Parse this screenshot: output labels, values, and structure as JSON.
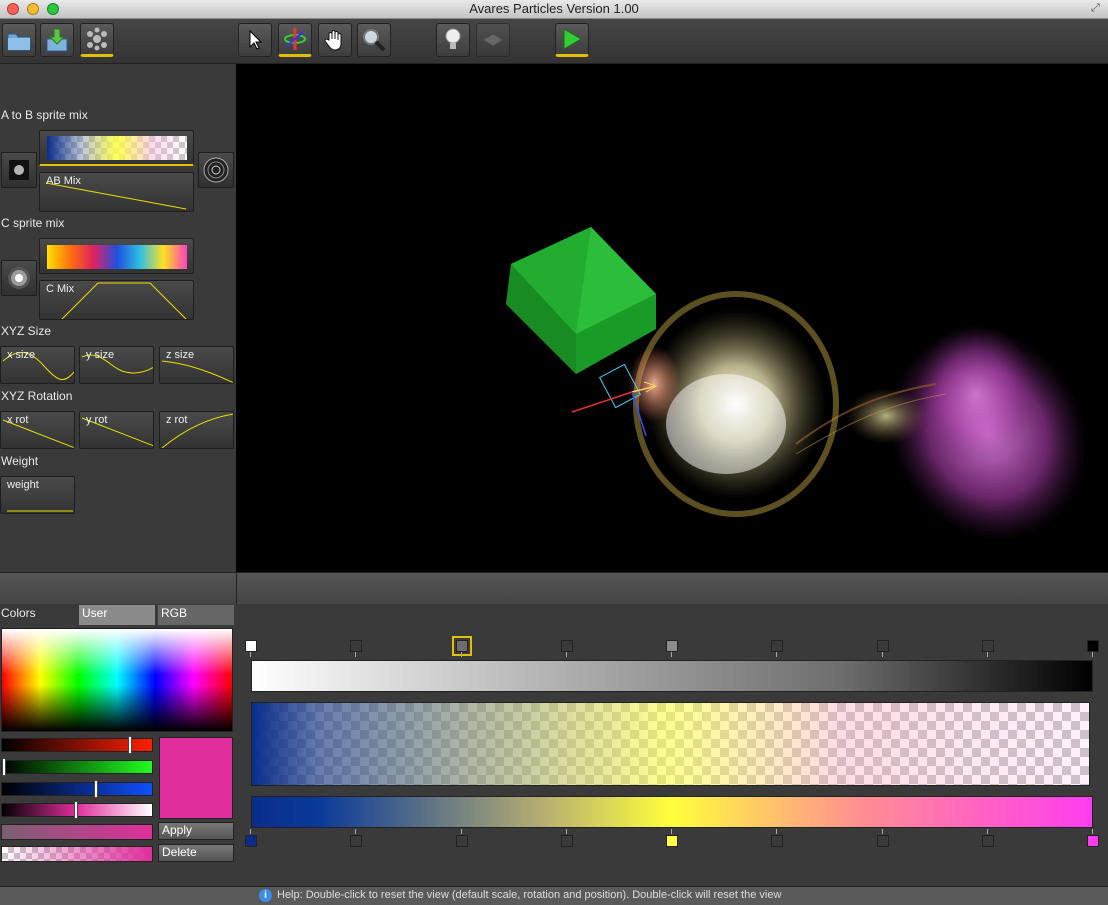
{
  "window": {
    "title": "Avares Particles Version 1.00",
    "colors": {
      "close": "#ff5f57",
      "minimize": "#ffbd2e",
      "zoom": "#28c940"
    }
  },
  "toolbar": {
    "buttons": [
      {
        "name": "open-folder-icon",
        "active": false
      },
      {
        "name": "import-download-icon",
        "active": false
      },
      {
        "name": "particles-icon",
        "active": true
      },
      {
        "name": "pointer-arrow-icon",
        "active": false
      },
      {
        "name": "rotate-gizmo-icon",
        "active": true
      },
      {
        "name": "hand-pan-icon",
        "active": false
      },
      {
        "name": "magnifier-zoom-icon",
        "active": false
      },
      {
        "name": "light-bulb-icon",
        "active": false
      },
      {
        "name": "render-grid-icon",
        "active": false
      },
      {
        "name": "play-icon",
        "active": true
      }
    ]
  },
  "left_panel": {
    "ab_section": {
      "label": "A to B sprite mix",
      "curve_label": "AB Mix"
    },
    "c_section": {
      "label": "C sprite mix",
      "curve_label": "C Mix"
    },
    "size_section": {
      "label": "XYZ Size",
      "x": "x size",
      "y": "y size",
      "z": "z size"
    },
    "rotation_section": {
      "label": "XYZ Rotation",
      "x": "x rot",
      "y": "y rot",
      "z": "z rot"
    },
    "weight_section": {
      "label": "Weight",
      "curve_label": "weight"
    }
  },
  "colors_panel": {
    "title": "Colors",
    "tabs": [
      "User",
      "RGB"
    ],
    "sliders": [
      {
        "name": "red-slider",
        "value": 0.86
      },
      {
        "name": "green-slider",
        "value": 0.0
      },
      {
        "name": "blue-slider",
        "value": 0.63
      },
      {
        "name": "alpha-slider",
        "value": 0.49
      }
    ],
    "current_color": "#e02f9c",
    "apply_label": "Apply",
    "delete_label": "Delete"
  },
  "gradient_editor": {
    "top_stops": [
      "#ffffff",
      "",
      "#6e6e6e",
      "",
      "#8c8c8c",
      "",
      "",
      "",
      "#000000"
    ],
    "selected_top_stop": 2,
    "bottom_stops": [
      "#0a2d8c",
      "",
      "",
      "",
      "#ffff3c",
      "",
      "",
      "",
      "#ff3cf0"
    ]
  },
  "status": {
    "help_text": "Help: Double-click to reset the view (default scale, rotation and position). Double-click will reset the view"
  }
}
